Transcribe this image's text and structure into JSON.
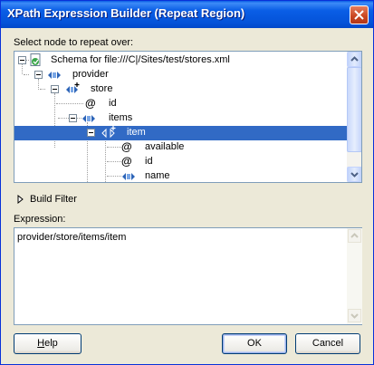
{
  "window": {
    "title": "XPath Expression Builder (Repeat Region)"
  },
  "tree_section": {
    "label": "Select node to repeat over:",
    "nodes": [
      {
        "label": "Schema for file:///C|/Sites/test/stores.xml",
        "type": "schema",
        "expanded": true
      },
      {
        "label": "provider",
        "type": "element",
        "expanded": true
      },
      {
        "label": "store",
        "type": "element-repeat",
        "expanded": true
      },
      {
        "label": "id",
        "type": "attribute"
      },
      {
        "label": "items",
        "type": "element",
        "expanded": true
      },
      {
        "label": "item",
        "type": "element-repeat",
        "expanded": true,
        "selected": true
      },
      {
        "label": "available",
        "type": "attribute"
      },
      {
        "label": "id",
        "type": "attribute"
      },
      {
        "label": "name",
        "type": "element"
      }
    ]
  },
  "build_filter": {
    "label": "Build Filter"
  },
  "expression": {
    "label": "Expression:",
    "value": "provider/store/items/item"
  },
  "buttons": {
    "help": {
      "pre": "",
      "accel": "H",
      "post": "elp"
    },
    "ok": "OK",
    "cancel": "Cancel"
  },
  "colors": {
    "selection": "#316ac5",
    "titlebar": "#0a5ee6",
    "dialog_bg": "#ece9d8"
  }
}
